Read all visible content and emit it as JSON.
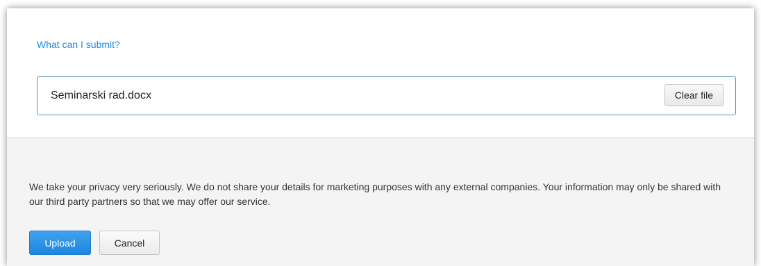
{
  "upload_form": {
    "help_link": "What can I submit?",
    "selected_file": "Seminarski rad.docx",
    "clear_file_label": "Clear file"
  },
  "footer": {
    "privacy_text": "We take your privacy very seriously. We do not share your details for marketing purposes with any external companies. Your information may only be shared with our third party partners so that we may offer our service.",
    "upload_label": "Upload",
    "cancel_label": "Cancel"
  },
  "colors": {
    "accent": "#1e88e5",
    "file_box_border": "#4a90c8",
    "footer_background": "#f4f4f4"
  }
}
